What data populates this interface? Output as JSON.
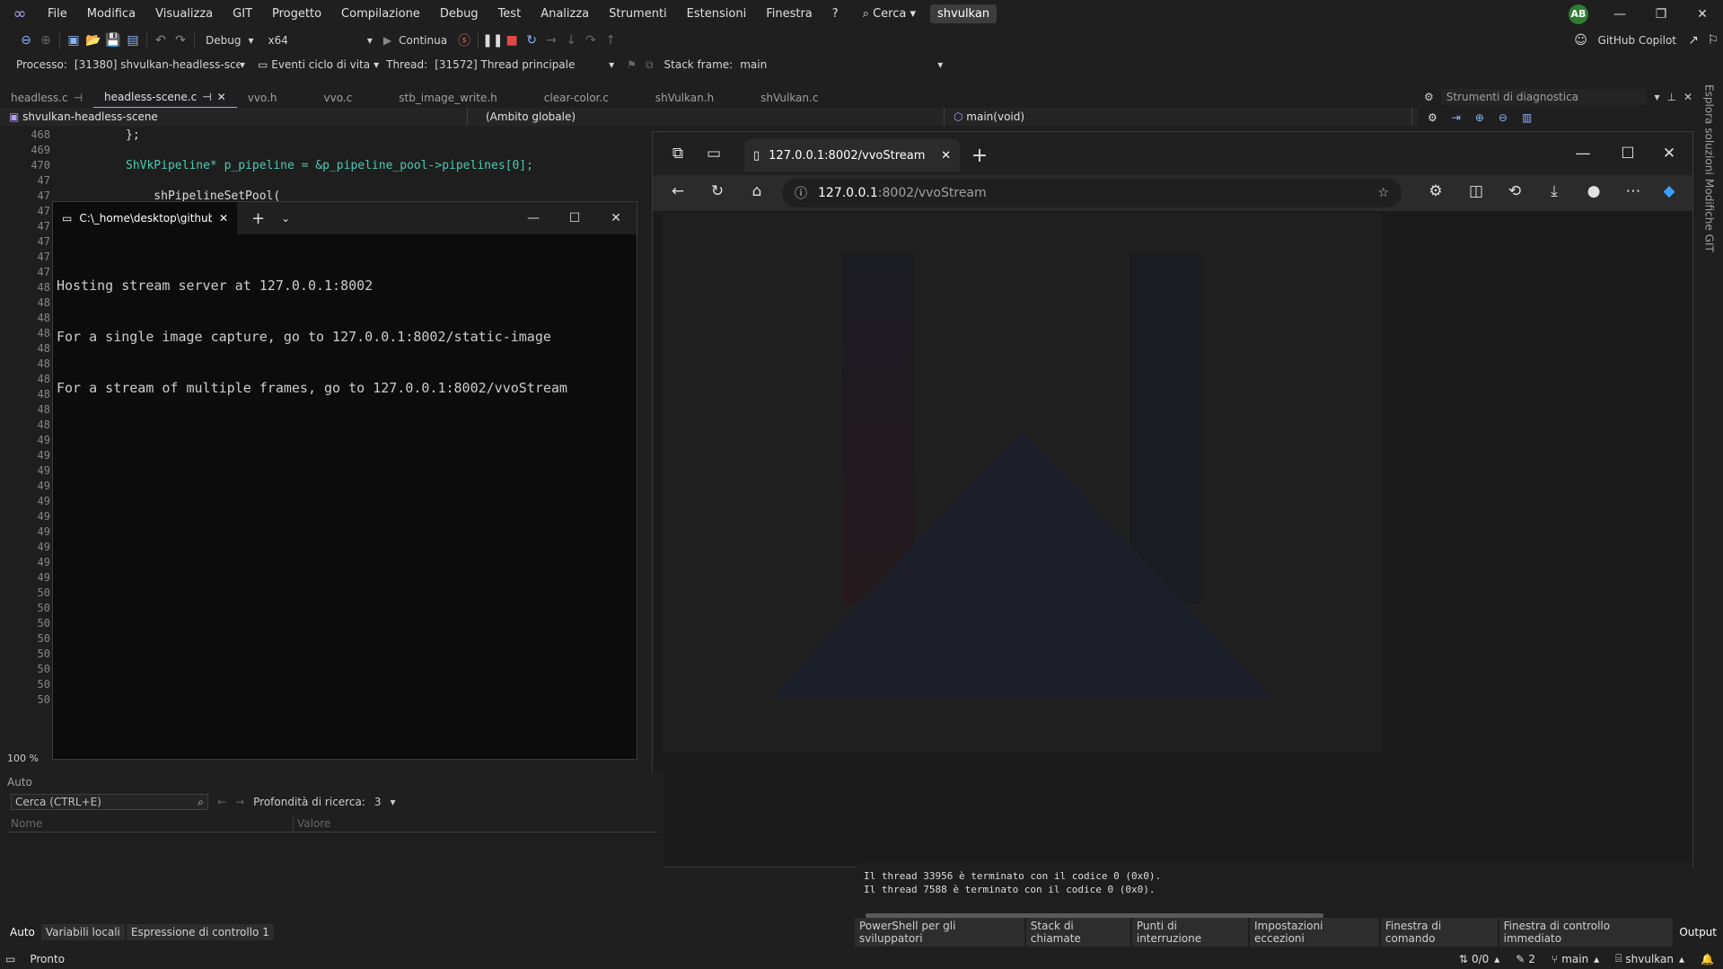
{
  "menubar": {
    "items": [
      "File",
      "Modifica",
      "Visualizza",
      "GIT",
      "Progetto",
      "Compilazione",
      "Debug",
      "Test",
      "Analizza",
      "Strumenti",
      "Estensioni",
      "Finestra",
      "?"
    ],
    "search_label": "Cerca",
    "solution": "shvulkan",
    "avatar_initials": "AB"
  },
  "toolbar": {
    "configuration": "Debug",
    "platform": "x64",
    "continue_label": "Continua",
    "copilot_label": "GitHub Copilot"
  },
  "debugbar": {
    "process_label": "Processo:",
    "process_value": "[31380] shvulkan-headless-scene.e",
    "lifecycle_label": "Eventi ciclo di vita",
    "thread_label": "Thread:",
    "thread_value": "[31572] Thread principale",
    "stackframe_label": "Stack frame:",
    "stackframe_value": "main"
  },
  "doc_tabs": [
    "headless.c",
    "headless-scene.c",
    "vvo.h",
    "vvo.c",
    "stb_image_write.h",
    "clear-color.c",
    "shVulkan.h",
    "shVulkan.c"
  ],
  "navbar": {
    "project": "shvulkan-headless-scene",
    "scope": "(Ambito globale)",
    "member": "main(void)"
  },
  "diagnostics": {
    "title": "Strumenti di diagnostica"
  },
  "rail": {
    "solution_explorer": "Esplora soluzioni",
    "git_changes": "Modifiche GIT"
  },
  "editor": {
    "line_numbers": [
      "468",
      "469",
      "470",
      "47",
      "47",
      "47",
      "47",
      "47",
      "47",
      "47",
      "48",
      "48",
      "48",
      "48",
      "48",
      "48",
      "48",
      "48",
      "48",
      "48",
      "49",
      "49",
      "49",
      "49",
      "49",
      "49",
      "49",
      "49",
      "49",
      "49",
      "50",
      "50",
      "50",
      "50",
      "50",
      "50",
      "50",
      "50"
    ],
    "code_lines": [
      "};",
      "",
      "ShVkPipeline* p_pipeline = &p_pipeline_pool->pipelines[0];",
      "",
      "    shPipelineSetPool("
    ],
    "zoom": "100 %"
  },
  "terminal": {
    "tab_title": "C:\\_home\\desktop\\github\\sh",
    "lines": [
      "Hosting stream server at 127.0.0.1:8002",
      "For a single image capture, go to 127.0.0.1:8002/static-image",
      "For a stream of multiple frames, go to 127.0.0.1:8002/vvoStream"
    ]
  },
  "browser": {
    "tab_title": "127.0.0.1:8002/vvoStream",
    "url_host": "127.0.0.1",
    "url_path": ":8002/vvoStream"
  },
  "auto_panel": {
    "title": "Auto",
    "search_placeholder": "Cerca (CTRL+E)",
    "depth_label": "Profondità di ricerca:",
    "depth_value": "3",
    "col_name": "Nome",
    "col_value": "Valore",
    "tabs": [
      "Auto",
      "Variabili locali",
      "Espressione di controllo 1"
    ]
  },
  "output_panel": {
    "lines": [
      "Il thread 33956 è terminato con il codice 0 (0x0).",
      "Il thread 7588 è terminato con il codice 0 (0x0)."
    ],
    "tabs": [
      "PowerShell per gli sviluppatori",
      "Stack di chiamate",
      "Punti di interruzione",
      "Impostazioni eccezioni",
      "Finestra di comando",
      "Finestra di controllo immediato",
      "Output"
    ]
  },
  "statusbar": {
    "ready": "Pronto",
    "changes": "0/0",
    "edits": "2",
    "branch": "main",
    "repo": "shvulkan"
  },
  "colors": {
    "accent": "#b59cf5",
    "terminal_bg": "#0c0c0c",
    "editor_bg": "#1e1e1e"
  }
}
